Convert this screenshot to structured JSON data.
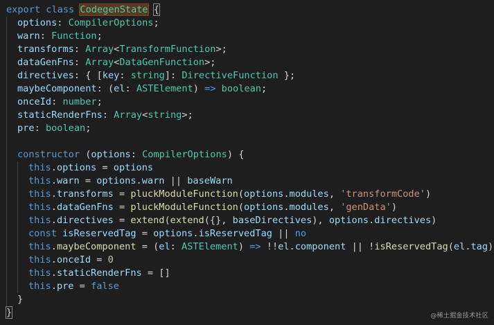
{
  "colors": {
    "background": "#1e1e1e",
    "keyword": "#569cd6",
    "control_keyword": "#c586c0",
    "property": "#9cdcfe",
    "type": "#4ec9b0",
    "function": "#dcdcaa",
    "string": "#ce9178",
    "number": "#b5cea8",
    "punctuation": "#d4d4d4",
    "highlight_bg": "#5a3a1e",
    "indent_guide": "#404040"
  },
  "code": {
    "lines": [
      {
        "indent": 0,
        "tokens": [
          [
            "kw",
            "export"
          ],
          [
            "plain",
            " "
          ],
          [
            "kw",
            "class"
          ],
          [
            "plain",
            " "
          ],
          [
            "hl",
            "CodegenState"
          ],
          [
            "plain",
            " "
          ],
          [
            "brk",
            "{"
          ]
        ]
      },
      {
        "indent": 1,
        "tokens": [
          [
            "prop",
            "options"
          ],
          [
            "punc",
            ": "
          ],
          [
            "type",
            "CompilerOptions"
          ],
          [
            "punc",
            ";"
          ]
        ]
      },
      {
        "indent": 1,
        "tokens": [
          [
            "prop",
            "warn"
          ],
          [
            "punc",
            ": "
          ],
          [
            "type",
            "Function"
          ],
          [
            "punc",
            ";"
          ]
        ]
      },
      {
        "indent": 1,
        "tokens": [
          [
            "prop",
            "transforms"
          ],
          [
            "punc",
            ": "
          ],
          [
            "type",
            "Array"
          ],
          [
            "punc",
            "<"
          ],
          [
            "type",
            "TransformFunction"
          ],
          [
            "punc",
            ">;"
          ]
        ]
      },
      {
        "indent": 1,
        "tokens": [
          [
            "prop",
            "dataGenFns"
          ],
          [
            "punc",
            ": "
          ],
          [
            "type",
            "Array"
          ],
          [
            "punc",
            "<"
          ],
          [
            "type",
            "DataGenFunction"
          ],
          [
            "punc",
            ">;"
          ]
        ]
      },
      {
        "indent": 1,
        "tokens": [
          [
            "prop",
            "directives"
          ],
          [
            "punc",
            ": { ["
          ],
          [
            "prop",
            "key"
          ],
          [
            "punc",
            ": "
          ],
          [
            "type",
            "string"
          ],
          [
            "punc",
            "]: "
          ],
          [
            "type",
            "DirectiveFunction"
          ],
          [
            "punc",
            " };"
          ]
        ]
      },
      {
        "indent": 1,
        "tokens": [
          [
            "prop",
            "maybeComponent"
          ],
          [
            "punc",
            ": ("
          ],
          [
            "prop",
            "el"
          ],
          [
            "punc",
            ": "
          ],
          [
            "type",
            "ASTElement"
          ],
          [
            "punc",
            ") "
          ],
          [
            "kw",
            "=>"
          ],
          [
            "plain",
            " "
          ],
          [
            "type",
            "boolean"
          ],
          [
            "punc",
            ";"
          ]
        ]
      },
      {
        "indent": 1,
        "tokens": [
          [
            "prop",
            "onceId"
          ],
          [
            "punc",
            ": "
          ],
          [
            "type",
            "number"
          ],
          [
            "punc",
            ";"
          ]
        ]
      },
      {
        "indent": 1,
        "tokens": [
          [
            "prop",
            "staticRenderFns"
          ],
          [
            "punc",
            ": "
          ],
          [
            "type",
            "Array"
          ],
          [
            "punc",
            "<"
          ],
          [
            "type",
            "string"
          ],
          [
            "punc",
            ">;"
          ]
        ]
      },
      {
        "indent": 1,
        "tokens": [
          [
            "prop",
            "pre"
          ],
          [
            "punc",
            ": "
          ],
          [
            "type",
            "boolean"
          ],
          [
            "punc",
            ";"
          ]
        ]
      },
      {
        "indent": 1,
        "tokens": []
      },
      {
        "indent": 1,
        "tokens": [
          [
            "kw",
            "constructor"
          ],
          [
            "plain",
            " "
          ],
          [
            "punc",
            "("
          ],
          [
            "prop",
            "options"
          ],
          [
            "punc",
            ": "
          ],
          [
            "type",
            "CompilerOptions"
          ],
          [
            "punc",
            ") {"
          ]
        ]
      },
      {
        "indent": 2,
        "tokens": [
          [
            "kw",
            "this"
          ],
          [
            "punc",
            "."
          ],
          [
            "prop",
            "options"
          ],
          [
            "punc",
            " = "
          ],
          [
            "prop",
            "options"
          ]
        ]
      },
      {
        "indent": 2,
        "tokens": [
          [
            "kw",
            "this"
          ],
          [
            "punc",
            "."
          ],
          [
            "prop",
            "warn"
          ],
          [
            "punc",
            " = "
          ],
          [
            "prop",
            "options"
          ],
          [
            "punc",
            "."
          ],
          [
            "prop",
            "warn"
          ],
          [
            "punc",
            " || "
          ],
          [
            "prop",
            "baseWarn"
          ]
        ]
      },
      {
        "indent": 2,
        "tokens": [
          [
            "kw",
            "this"
          ],
          [
            "punc",
            "."
          ],
          [
            "prop",
            "transforms"
          ],
          [
            "punc",
            " = "
          ],
          [
            "func",
            "pluckModuleFunction"
          ],
          [
            "punc",
            "("
          ],
          [
            "prop",
            "options"
          ],
          [
            "punc",
            "."
          ],
          [
            "prop",
            "modules"
          ],
          [
            "punc",
            ", "
          ],
          [
            "str",
            "'transformCode'"
          ],
          [
            "punc",
            ")"
          ]
        ]
      },
      {
        "indent": 2,
        "tokens": [
          [
            "kw",
            "this"
          ],
          [
            "punc",
            "."
          ],
          [
            "prop",
            "dataGenFns"
          ],
          [
            "punc",
            " = "
          ],
          [
            "func",
            "pluckModuleFunction"
          ],
          [
            "punc",
            "("
          ],
          [
            "prop",
            "options"
          ],
          [
            "punc",
            "."
          ],
          [
            "prop",
            "modules"
          ],
          [
            "punc",
            ", "
          ],
          [
            "str",
            "'genData'"
          ],
          [
            "punc",
            ")"
          ]
        ]
      },
      {
        "indent": 2,
        "tokens": [
          [
            "kw",
            "this"
          ],
          [
            "punc",
            "."
          ],
          [
            "prop",
            "directives"
          ],
          [
            "punc",
            " = "
          ],
          [
            "func",
            "extend"
          ],
          [
            "punc",
            "("
          ],
          [
            "func",
            "extend"
          ],
          [
            "punc",
            "({}, "
          ],
          [
            "prop",
            "baseDirectives"
          ],
          [
            "punc",
            "), "
          ],
          [
            "prop",
            "options"
          ],
          [
            "punc",
            "."
          ],
          [
            "prop",
            "directives"
          ],
          [
            "punc",
            ")"
          ]
        ]
      },
      {
        "indent": 2,
        "tokens": [
          [
            "kw",
            "const"
          ],
          [
            "plain",
            " "
          ],
          [
            "prop",
            "isReservedTag"
          ],
          [
            "punc",
            " = "
          ],
          [
            "prop",
            "options"
          ],
          [
            "punc",
            "."
          ],
          [
            "prop",
            "isReservedTag"
          ],
          [
            "punc",
            " || "
          ],
          [
            "kw",
            "no"
          ]
        ]
      },
      {
        "indent": 2,
        "tokens": [
          [
            "kw",
            "this"
          ],
          [
            "punc",
            "."
          ],
          [
            "func",
            "maybeComponent"
          ],
          [
            "punc",
            " = ("
          ],
          [
            "prop",
            "el"
          ],
          [
            "punc",
            ": "
          ],
          [
            "type",
            "ASTElement"
          ],
          [
            "punc",
            ") "
          ],
          [
            "kw",
            "=>"
          ],
          [
            "punc",
            " !!"
          ],
          [
            "prop",
            "el"
          ],
          [
            "punc",
            "."
          ],
          [
            "prop",
            "component"
          ],
          [
            "punc",
            " || !"
          ],
          [
            "func",
            "isReservedTag"
          ],
          [
            "punc",
            "("
          ],
          [
            "prop",
            "el"
          ],
          [
            "punc",
            "."
          ],
          [
            "prop",
            "tag"
          ],
          [
            "punc",
            ")"
          ]
        ]
      },
      {
        "indent": 2,
        "tokens": [
          [
            "kw",
            "this"
          ],
          [
            "punc",
            "."
          ],
          [
            "prop",
            "onceId"
          ],
          [
            "punc",
            " = "
          ],
          [
            "num",
            "0"
          ]
        ]
      },
      {
        "indent": 2,
        "tokens": [
          [
            "kw",
            "this"
          ],
          [
            "punc",
            "."
          ],
          [
            "prop",
            "staticRenderFns"
          ],
          [
            "punc",
            " = []"
          ]
        ]
      },
      {
        "indent": 2,
        "tokens": [
          [
            "kw",
            "this"
          ],
          [
            "punc",
            "."
          ],
          [
            "prop",
            "pre"
          ],
          [
            "punc",
            " = "
          ],
          [
            "kw",
            "false"
          ]
        ]
      },
      {
        "indent": 1,
        "tokens": [
          [
            "punc",
            "}"
          ]
        ]
      },
      {
        "indent": 0,
        "tokens": [
          [
            "brk",
            "}"
          ]
        ]
      }
    ]
  },
  "watermark": "@稀土掘金技术社区"
}
